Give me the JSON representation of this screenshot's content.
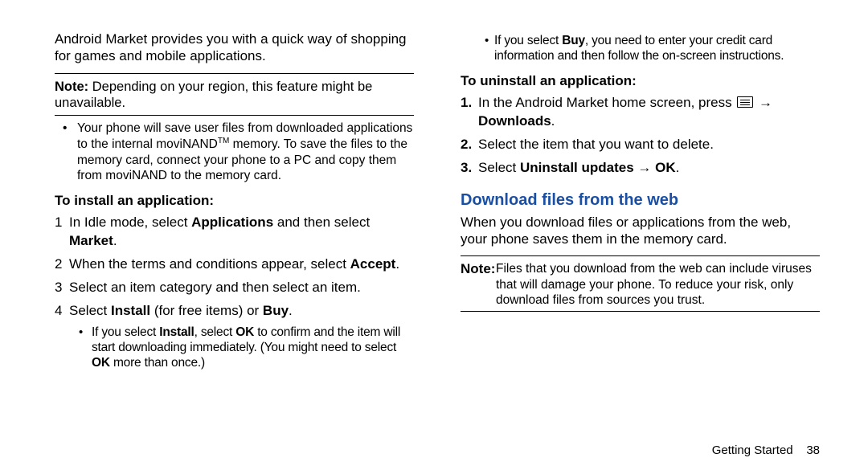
{
  "left": {
    "intro": "Android Market provides you with a quick way of shopping for games and mobile applications.",
    "note_label": "Note:",
    "note_text": " Depending on your region, this feature might be unavailable.",
    "bullet1_a": "Your phone will save user files from downloaded applications to the internal moviNAND",
    "bullet1_tm": "TM",
    "bullet1_b": " memory. To save the files to the memory card, connect your phone to a PC and copy them from moviNAND to the memory card.",
    "sub_install": "To install an application:",
    "s1_a": "In Idle mode, select ",
    "s1_b": "Applications",
    "s1_c": " and then select ",
    "s1_d": "Market",
    "s1_e": ".",
    "s2_a": "When the terms and conditions appear, select ",
    "s2_b": "Accept",
    "s2_c": ".",
    "s3": "Select an item category and then select an item.",
    "s4_a": "Select ",
    "s4_b": "Install",
    "s4_c": " (for free items) or ",
    "s4_d": "Buy",
    "s4_e": ".",
    "sb1_a": "If you select ",
    "sb1_b": "Install",
    "sb1_c": ", select ",
    "sb1_d": "OK",
    "sb1_e": " to confirm and the item will start downloading immediately. (You might need to select ",
    "sb1_f": "OK",
    "sb1_g": " more than once.)"
  },
  "right": {
    "sb2_a": "If you select ",
    "sb2_b": "Buy",
    "sb2_c": ", you need to enter your credit card information and then follow the on-screen instructions.",
    "sub_uninstall": "To uninstall an application:",
    "u1_a": "In the Android Market home screen, press ",
    "u1_arrow": " → ",
    "u1_b": "Downloads",
    "u1_c": ".",
    "u2": "Select the item that you want to delete.",
    "u3_a": "Select ",
    "u3_b": "Uninstall updates → OK",
    "u3_c": ".",
    "heading": "Download files from the web",
    "para": "When you download files or applications from the web, your phone saves them in the memory card.",
    "note_label": "Note:",
    "note_text": "Files that you download from the web can include viruses that will damage your phone. To reduce your risk, only download files from sources you trust."
  },
  "footer_text": "Getting Started",
  "footer_page": "38"
}
